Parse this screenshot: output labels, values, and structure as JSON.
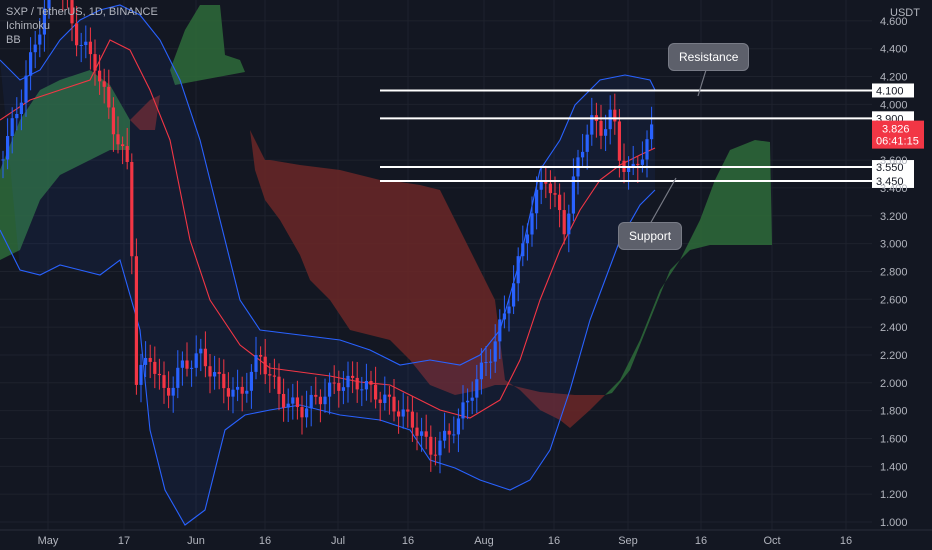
{
  "header": {
    "symbol_line": "SXP / TetherUS, 1D, BINANCE",
    "indicators": [
      "Ichimoku",
      "BB"
    ]
  },
  "chart_data": {
    "type": "candlestick",
    "ylabel": "USDT",
    "ylim": [
      0.95,
      5.5
    ],
    "y_ticks": [
      1.0,
      1.2,
      1.4,
      1.6,
      1.8,
      2.0,
      2.2,
      2.4,
      2.6,
      2.8,
      3.0,
      3.2,
      3.4,
      3.6,
      4.0,
      4.2,
      4.4,
      4.6,
      4.8
    ],
    "y_tick_labels": [
      "1.000",
      "1.200",
      "1.400",
      "1.600",
      "1.800",
      "2.000",
      "2.200",
      "2.400",
      "2.600",
      "2.800",
      "3.000",
      "3.200",
      "3.400",
      "3.600",
      "4.000",
      "4.200",
      "4.400",
      "4.600",
      "4.800"
    ],
    "x_labels": [
      "May",
      "17",
      "Jun",
      "16",
      "Jul",
      "16",
      "Aug",
      "16",
      "Sep",
      "16",
      "Oct",
      "16"
    ],
    "levels": [
      {
        "label": "4.100",
        "value": 4.1
      },
      {
        "label": "3.900",
        "value": 3.9
      },
      {
        "label": "3.550",
        "value": 3.55
      },
      {
        "label": "3.450",
        "value": 3.45
      }
    ],
    "current_price": "3.826",
    "countdown": "06:41:15",
    "annotations": [
      "Resistance",
      "Support"
    ],
    "colors": {
      "up": "#2962ff",
      "down": "#f23645",
      "kumo_bull": "#2e6b3a",
      "kumo_bear": "#6b2727",
      "bb_line": "#2962ff",
      "basis": "#f23645",
      "background": "#131722"
    }
  }
}
